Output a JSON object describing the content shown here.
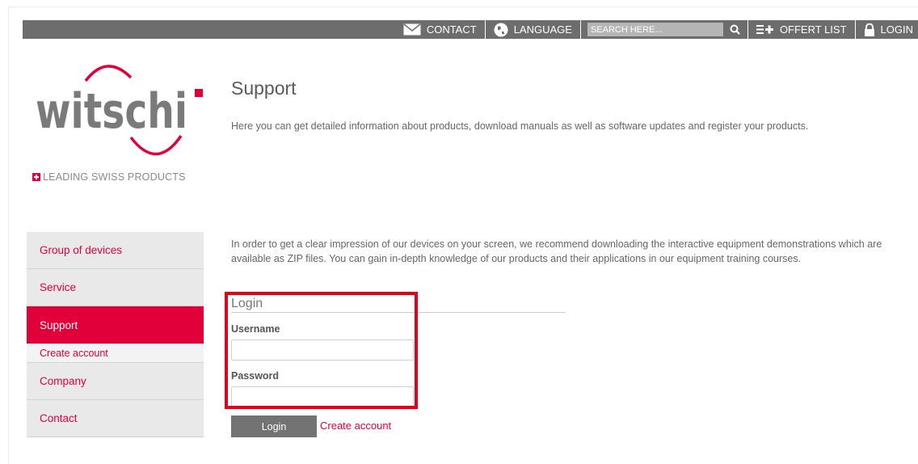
{
  "topnav": {
    "contact": "CONTACT",
    "language": "LANGUAGE",
    "search_placeholder": "SEARCH HERE...",
    "offer_list": "OFFERT LIST",
    "login": "LOGIN"
  },
  "brand": {
    "name": "witschi",
    "tagline": "LEADING SWISS PRODUCTS",
    "accent_color": "#e2003a"
  },
  "page": {
    "title": "Support",
    "intro": "Here you can get detailed information about products, download manuals as well as software updates and register your products.",
    "paragraph": "In order to get a clear impression of our devices on your screen, we recommend downloading the interactive equipment demonstrations which are available as ZIP files. You can gain in-depth knowledge of our products and their applications in our equipment training courses."
  },
  "sidebar": {
    "items": [
      {
        "label": "Group of devices"
      },
      {
        "label": "Service"
      },
      {
        "label": "Support"
      },
      {
        "label": "Create account"
      },
      {
        "label": "Company"
      },
      {
        "label": "Contact"
      }
    ]
  },
  "login": {
    "title": "Login",
    "username_label": "Username",
    "username_value": "",
    "password_label": "Password",
    "password_value": "",
    "button": "Login",
    "create_account": "Create account"
  }
}
